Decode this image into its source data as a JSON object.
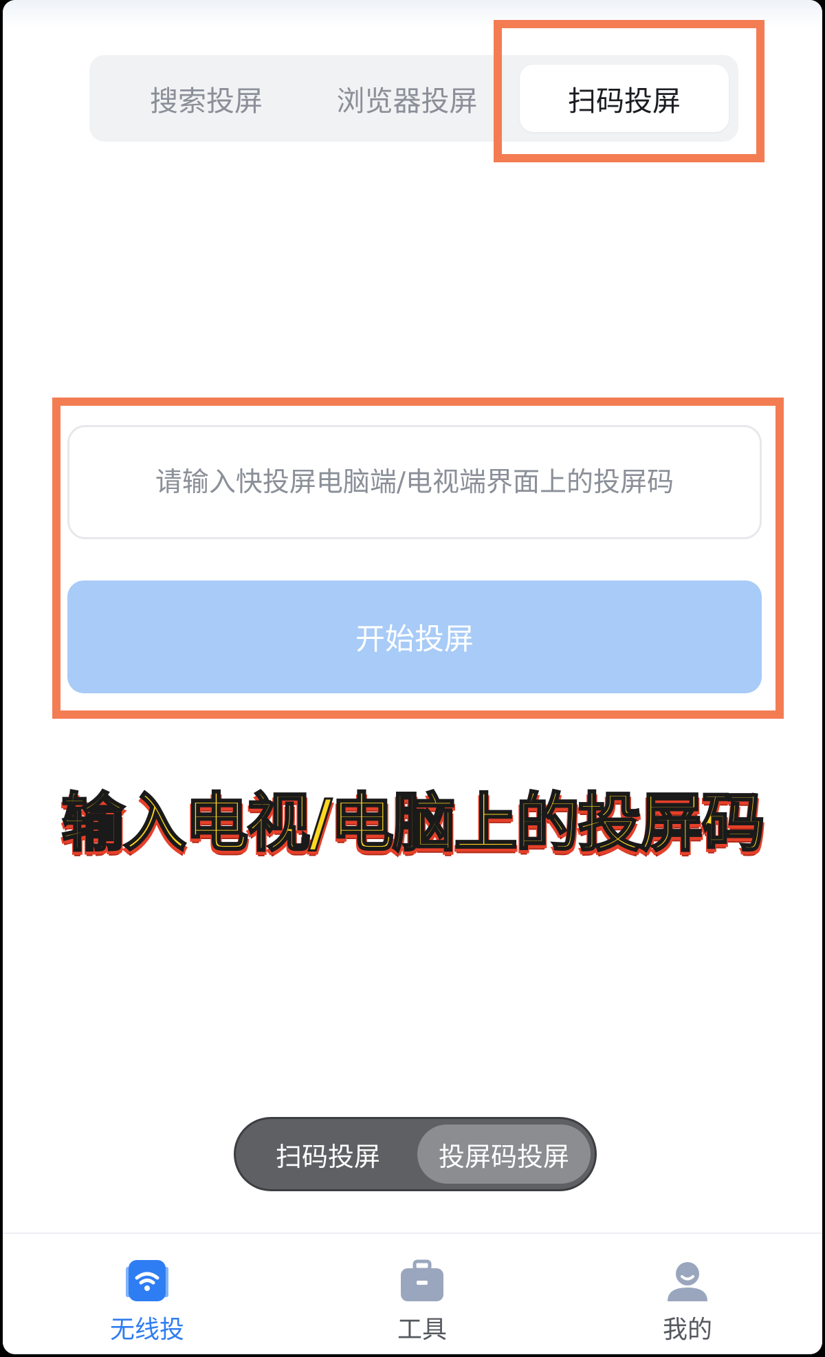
{
  "tabs": [
    {
      "label": "搜索投屏",
      "active": false
    },
    {
      "label": "浏览器投屏",
      "active": false
    },
    {
      "label": "扫码投屏",
      "active": true
    }
  ],
  "code_input": {
    "placeholder": "请输入快投屏电脑端/电视端界面上的投屏码",
    "value": ""
  },
  "start_button": {
    "label": "开始投屏"
  },
  "caption": "输入电视/电脑上的投屏码",
  "mode_toggle": {
    "options": [
      "扫码投屏",
      "投屏码投屏"
    ],
    "selected": "投屏码投屏"
  },
  "bottom_nav": {
    "items": [
      {
        "label": "无线投",
        "icon": "wifi-cast-icon",
        "active": true
      },
      {
        "label": "工具",
        "icon": "toolbox-icon",
        "active": false
      },
      {
        "label": "我的",
        "icon": "profile-icon",
        "active": false
      }
    ]
  },
  "colors": {
    "accent": "#2f7df2",
    "button_disabled": "#a8cbf7",
    "highlight_box": "#f47c53",
    "caption_fill": "#ffd61f",
    "caption_shadow": "#e5402a"
  }
}
